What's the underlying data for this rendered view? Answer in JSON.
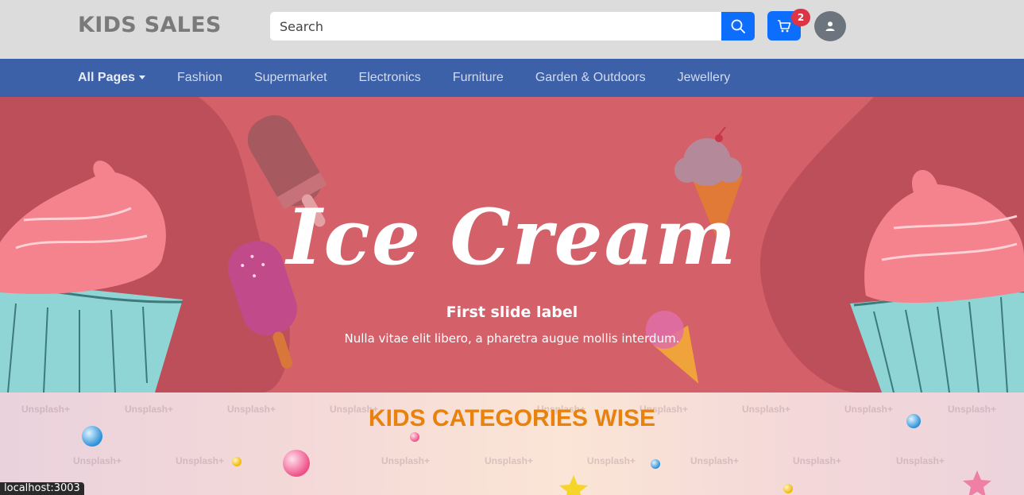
{
  "header": {
    "brand": "KIDS SALES",
    "search": {
      "placeholder": "Search",
      "value": ""
    },
    "cart": {
      "count": "2"
    },
    "icons": {
      "search": "search-icon",
      "cart": "cart-icon",
      "user": "user-icon"
    }
  },
  "nav": {
    "items": [
      {
        "label": "All Pages",
        "active": true
      },
      {
        "label": "Fashion"
      },
      {
        "label": "Supermarket"
      },
      {
        "label": "Electronics"
      },
      {
        "label": "Furniture"
      },
      {
        "label": "Garden & Outdoors"
      },
      {
        "label": "Jewellery"
      }
    ]
  },
  "hero": {
    "title": "Ice Cream",
    "slide_label": "First slide label",
    "slide_text": "Nulla vitae elit libero, a pharetra augue mollis interdum."
  },
  "categories": {
    "title": "KIDS CATEGORIES WISE",
    "watermark": "Unsplash+"
  },
  "status_bar": {
    "url": "localhost:3003"
  },
  "colors": {
    "topbar": "#dcdcdc",
    "navbar": "#3d61a8",
    "primary": "#0d6efd",
    "badge": "#dc3545",
    "hero": "#d4606a",
    "category_title": "#e8820c"
  }
}
